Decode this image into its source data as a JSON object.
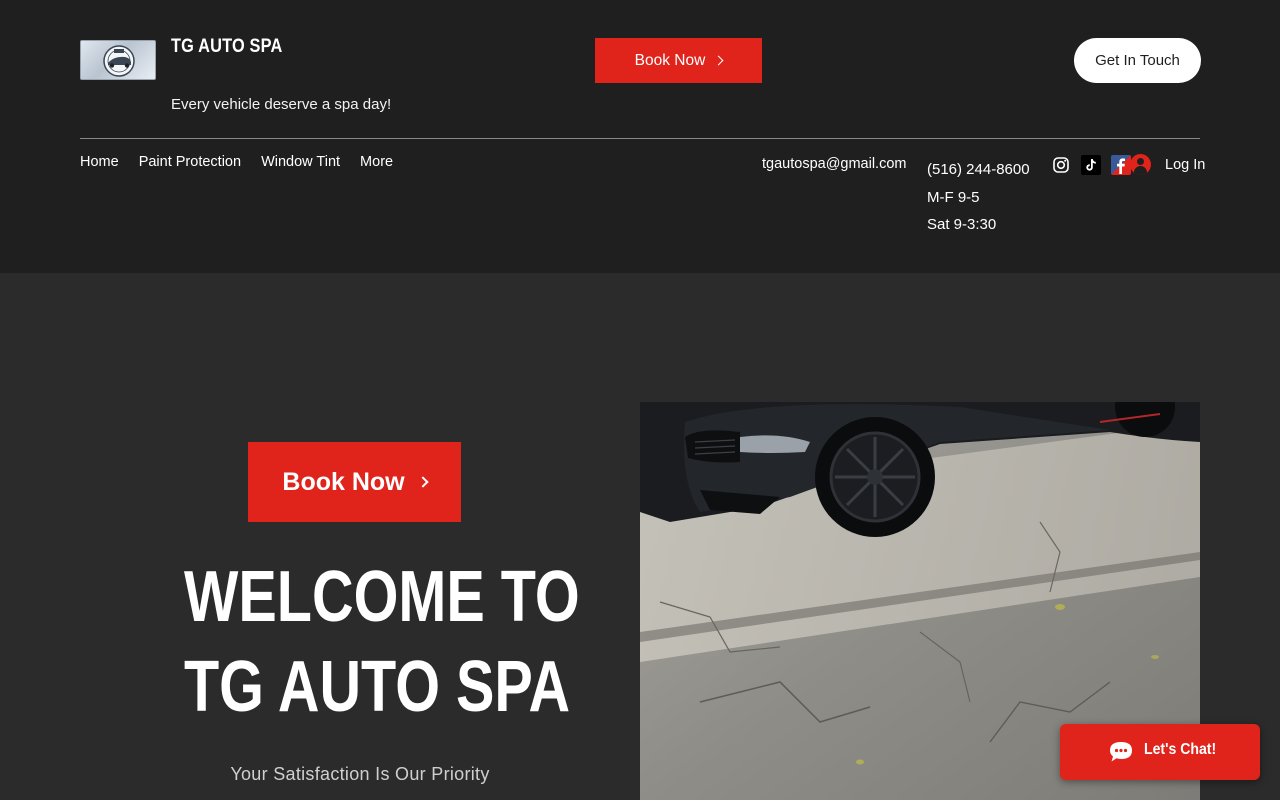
{
  "header": {
    "brand": "TG AUTO SPA",
    "tagline": "Every vehicle deserve a spa day!",
    "book_now": "Book Now",
    "get_in_touch": "Get In Touch",
    "nav": [
      "Home",
      "Paint Protection",
      "Window Tint",
      "More"
    ],
    "email": "tgautospa@gmail.com",
    "phone": "(516) 244-8600",
    "hours_weekday": "M-F 9-5",
    "hours_saturday": "Sat 9-3:30",
    "social_icons": [
      "instagram-icon",
      "tiktok-icon",
      "facebook-icon"
    ],
    "login": "Log In"
  },
  "hero": {
    "book_now": "Book Now",
    "title_line1": "WELCOME TO",
    "title_line2": "TG AUTO SPA",
    "subtitle": "Your Satisfaction Is Our Priority"
  },
  "chat": {
    "label": "Let's Chat!"
  },
  "colors": {
    "accent": "#e0231b",
    "header_bg": "#1f1f1f",
    "page_bg": "#2b2b2b"
  }
}
